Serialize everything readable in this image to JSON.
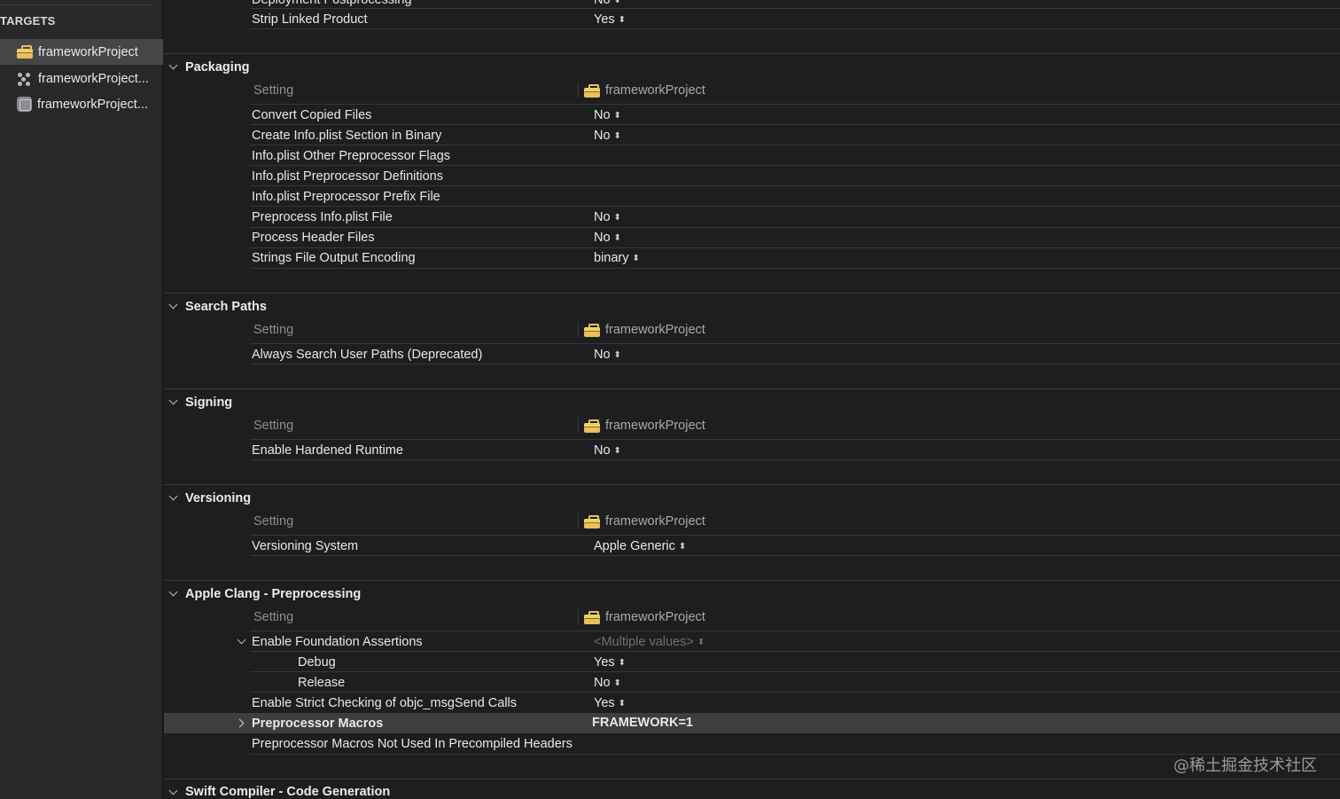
{
  "sidebar": {
    "title": "TARGETS",
    "items": [
      {
        "label": "frameworkProject",
        "icon": "toolbox-icon"
      },
      {
        "label": "frameworkProject...",
        "icon": "dots-cluster-icon"
      },
      {
        "label": "frameworkProject...",
        "icon": "app-bundle-icon"
      }
    ]
  },
  "top_partial": {
    "deployment_label": "Deployment Postprocessing",
    "deployment_value": "No",
    "strip_label": "Strip Linked Product",
    "strip_value": "Yes"
  },
  "column_header": {
    "setting": "Setting",
    "target": "frameworkProject"
  },
  "sections": {
    "packaging": {
      "title": "Packaging",
      "rows": [
        {
          "label": "Convert Copied Files",
          "value": "No"
        },
        {
          "label": "Create Info.plist Section in Binary",
          "value": "No"
        },
        {
          "label": "Info.plist Other Preprocessor Flags",
          "value": ""
        },
        {
          "label": "Info.plist Preprocessor Definitions",
          "value": ""
        },
        {
          "label": "Info.plist Preprocessor Prefix File",
          "value": ""
        },
        {
          "label": "Preprocess Info.plist File",
          "value": "No"
        },
        {
          "label": "Process Header Files",
          "value": "No"
        },
        {
          "label": "Strings File Output Encoding",
          "value": "binary"
        }
      ]
    },
    "search_paths": {
      "title": "Search Paths",
      "rows": [
        {
          "label": "Always Search User Paths (Deprecated)",
          "value": "No"
        }
      ]
    },
    "signing": {
      "title": "Signing",
      "rows": [
        {
          "label": "Enable Hardened Runtime",
          "value": "No"
        }
      ]
    },
    "versioning": {
      "title": "Versioning",
      "rows": [
        {
          "label": "Versioning System",
          "value": "Apple Generic"
        }
      ]
    },
    "clang": {
      "title": "Apple Clang - Preprocessing",
      "foundation": {
        "label": "Enable Foundation Assertions",
        "value": "<Multiple values>"
      },
      "debug": {
        "label": "Debug",
        "value": "Yes"
      },
      "release": {
        "label": "Release",
        "value": "No"
      },
      "strict": {
        "label": "Enable Strict Checking of objc_msgSend Calls",
        "value": "Yes"
      },
      "macros": {
        "label": "Preprocessor Macros",
        "value": "FRAMEWORK=1"
      },
      "macros_not_used": {
        "label": "Preprocessor Macros Not Used In Precompiled Headers",
        "value": ""
      }
    },
    "swift": {
      "title": "Swift Compiler - Code Generation"
    }
  },
  "updown_glyph": "⌃⌄",
  "watermark": "@稀土掘金技术社区"
}
